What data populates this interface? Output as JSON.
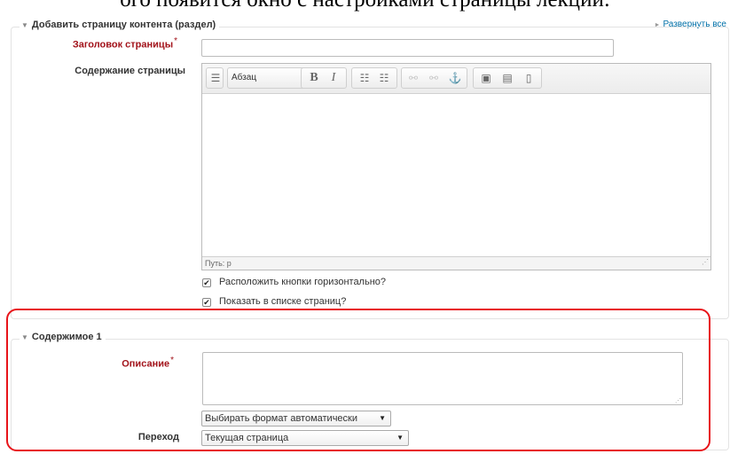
{
  "document": {
    "heading_fragment": "ого появится окно с настройками страницы лекции:"
  },
  "header": {
    "expand_all": "Развернуть все"
  },
  "section_content_page": {
    "legend": "Добавить страницу контента (раздел)",
    "page_title_label": "Заголовок страницы",
    "page_title_value": "",
    "page_content_label": "Содержание страницы",
    "editor": {
      "format_value": "Абзац",
      "path_label": "Путь: p",
      "toolbar_icons": [
        "toolbar-toggle-icon",
        "bold-icon",
        "italic-icon",
        "bullet-list-icon",
        "numbered-list-icon",
        "link-icon",
        "unlink-icon",
        "anchor-icon",
        "image-icon",
        "media-icon",
        "paste-icon"
      ]
    },
    "checkbox_horizontal": {
      "label": "Расположить кнопки горизонтально?",
      "checked": true
    },
    "checkbox_show_in_list": {
      "label": "Показать в списке страниц?",
      "checked": true
    }
  },
  "section_content1": {
    "legend": "Содержимое 1",
    "description_label": "Описание",
    "description_value": "",
    "format_select": "Выбирать формат автоматически",
    "jump_label": "Переход",
    "jump_select": "Текущая страница"
  },
  "colors": {
    "required_label": "#a2121a",
    "highlight_border": "#e8141a",
    "link": "#0070a8"
  }
}
